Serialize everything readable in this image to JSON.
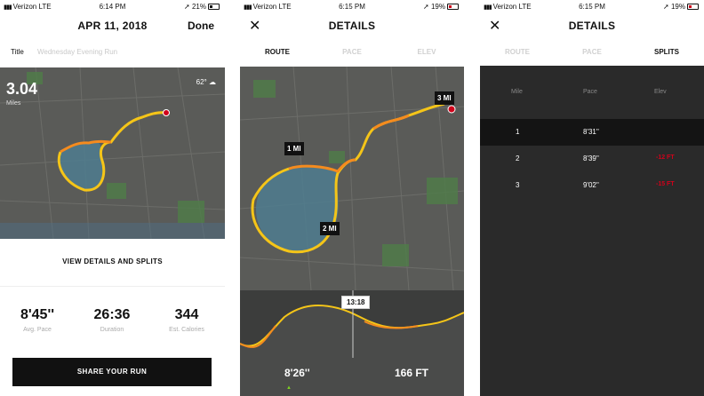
{
  "screen1": {
    "status": {
      "carrier": "Verizon  LTE",
      "time": "6:14 PM",
      "battery": "21%"
    },
    "nav": {
      "title": "APR 11, 2018",
      "done_label": "Done"
    },
    "title_row": {
      "label": "Title",
      "value": "Wednesday Evening Run"
    },
    "map": {
      "distance": "3.04",
      "unit": "Miles",
      "temperature": "62°"
    },
    "details_link": "VIEW DETAILS AND SPLITS",
    "stats": [
      {
        "value": "8'45''",
        "label": "Avg. Pace"
      },
      {
        "value": "26:36",
        "label": "Duration"
      },
      {
        "value": "344",
        "label": "Est. Calories"
      }
    ],
    "share_label": "SHARE YOUR RUN"
  },
  "screen2": {
    "status": {
      "carrier": "Verizon  LTE",
      "time": "6:15 PM",
      "battery": "19%"
    },
    "nav": {
      "close_glyph": "✕",
      "title": "DETAILS"
    },
    "tabs": [
      "ROUTE",
      "PACE",
      "ELEV"
    ],
    "mile_markers": [
      "1 MI",
      "2 MI",
      "3 MI"
    ],
    "chart_time": "13:18",
    "pace_value": "8'26''",
    "elevation_value": "166 FT"
  },
  "screen3": {
    "status": {
      "carrier": "Verizon  LTE",
      "time": "6:15 PM",
      "battery": "19%"
    },
    "nav": {
      "close_glyph": "✕",
      "title": "DETAILS"
    },
    "tabs": [
      "ROUTE",
      "PACE",
      "SPLITS"
    ],
    "columns": [
      "Mile",
      "Pace",
      "Elev"
    ],
    "rows": [
      {
        "mile": "1",
        "pace": "8'31''",
        "elev": ""
      },
      {
        "mile": "2",
        "pace": "8'39''",
        "elev": "-12 FT"
      },
      {
        "mile": "3",
        "pace": "9'02''",
        "elev": "-15 FT"
      }
    ]
  },
  "colors": {
    "route_start": "#f5a623",
    "route_end": "#f8e71c",
    "accent_red": "#d0021b",
    "map_bg": "#5a5b58"
  }
}
